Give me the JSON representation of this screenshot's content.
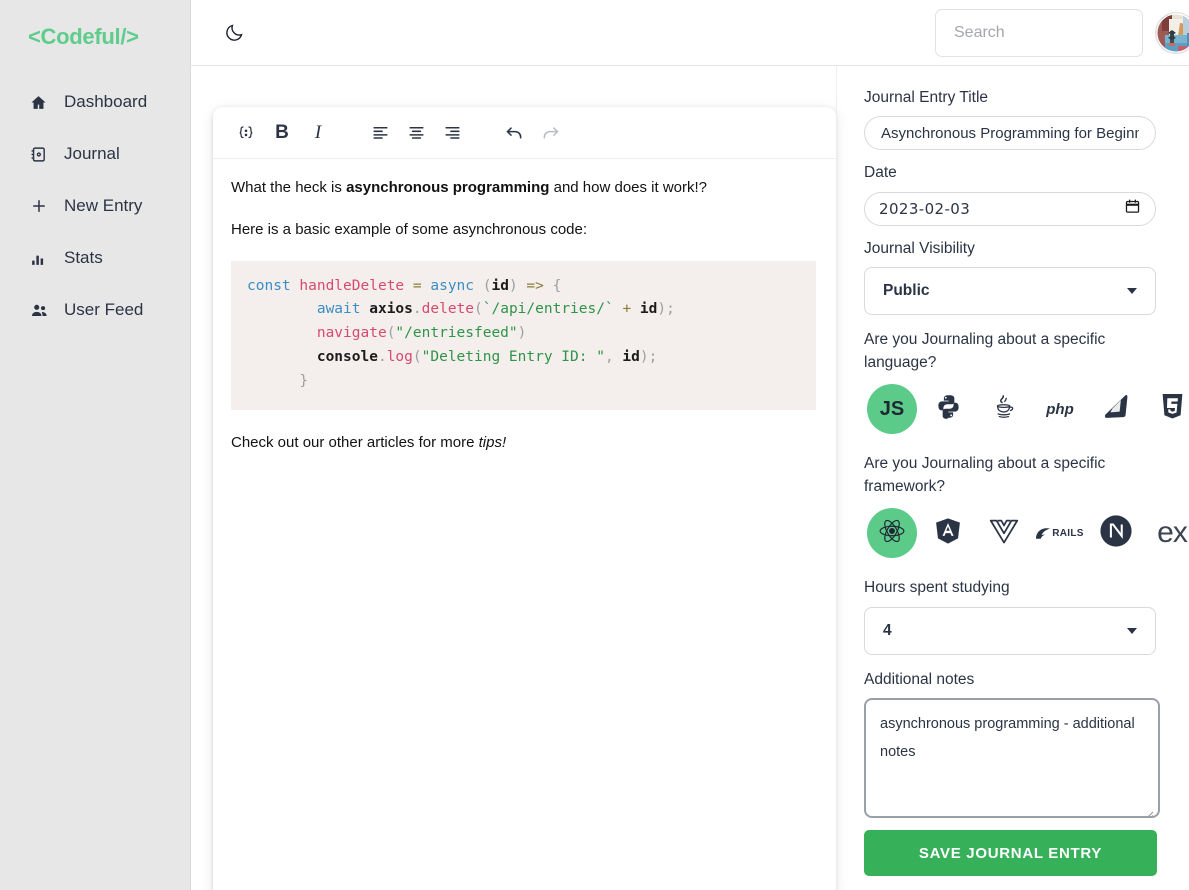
{
  "brand": "<Codeful/>",
  "sidebar": {
    "items": [
      {
        "label": "Dashboard",
        "icon": "home-icon"
      },
      {
        "label": "Journal",
        "icon": "book-icon"
      },
      {
        "label": "New Entry",
        "icon": "plus-icon"
      },
      {
        "label": "Stats",
        "icon": "bar-chart-icon"
      },
      {
        "label": "User Feed",
        "icon": "users-icon"
      }
    ]
  },
  "topbar": {
    "theme_toggle_icon": "moon-icon",
    "search": {
      "value": "",
      "placeholder": "Search"
    },
    "avatar_alt": "user-avatar"
  },
  "editor": {
    "toolbar": [
      {
        "name": "code-block-icon",
        "label": "{;}"
      },
      {
        "name": "bold-button",
        "label": "B"
      },
      {
        "name": "italic-button",
        "label": "I"
      },
      {
        "name": "align-left-icon",
        "label": ""
      },
      {
        "name": "align-center-icon",
        "label": ""
      },
      {
        "name": "align-right-icon",
        "label": ""
      },
      {
        "name": "undo-icon",
        "label": ""
      },
      {
        "name": "redo-icon",
        "label": ""
      }
    ],
    "paragraph_1_pre": "What the heck is ",
    "paragraph_1_bold": "asynchronous programming",
    "paragraph_1_post": " and how does it work!?",
    "paragraph_2": "Here is a basic example of some asynchronous code:",
    "paragraph_3_pre": "Check out our other articles for more ",
    "paragraph_3_italic": "tips!",
    "code_lines": [
      "const handleDelete = async (id) => {",
      "        await axios.delete(`/api/entries/` + id);",
      "        navigate(\"/entriesfeed\")",
      "        console.log(\"Deleting Entry ID: \", id);",
      "      }"
    ]
  },
  "form": {
    "title_label": "Journal Entry Title",
    "title_value": "Asynchronous Programming for Beginners",
    "title_placeholder": "",
    "date_label": "Date",
    "date_value": "2023-02-03",
    "visibility_label": "Journal Visibility",
    "visibility_value": "Public",
    "language_label": "Are you Journaling about a specific language?",
    "languages": [
      {
        "name": "javascript",
        "label": "JS",
        "selected": true
      },
      {
        "name": "python",
        "label": "",
        "selected": false
      },
      {
        "name": "java",
        "label": "",
        "selected": false
      },
      {
        "name": "php",
        "label": "php",
        "selected": false
      },
      {
        "name": "ruby",
        "label": "",
        "selected": false
      },
      {
        "name": "css3",
        "label": "",
        "selected": false
      }
    ],
    "framework_label": "Are you Journaling about a specific framework?",
    "frameworks": [
      {
        "name": "react",
        "label": "",
        "selected": true
      },
      {
        "name": "angular",
        "label": "A",
        "selected": false
      },
      {
        "name": "vue",
        "label": "",
        "selected": false
      },
      {
        "name": "rails",
        "label": "RAILS",
        "selected": false
      },
      {
        "name": "nextjs",
        "label": "N",
        "selected": false
      },
      {
        "name": "express",
        "label": "ex",
        "selected": false
      }
    ],
    "hours_label": "Hours spent studying",
    "hours_value": "4",
    "notes_label": "Additional notes",
    "notes_value": "asynchronous programming - additional notes",
    "save_label": "SAVE JOURNAL ENTRY"
  },
  "colors": {
    "brand_green": "#5fcc8c",
    "save_green": "#36b059",
    "selected_green": "#5ccb8a",
    "sidebar_bg": "#e7e7e7",
    "code_bg": "#f4efec",
    "text_dark": "#2b3445"
  }
}
